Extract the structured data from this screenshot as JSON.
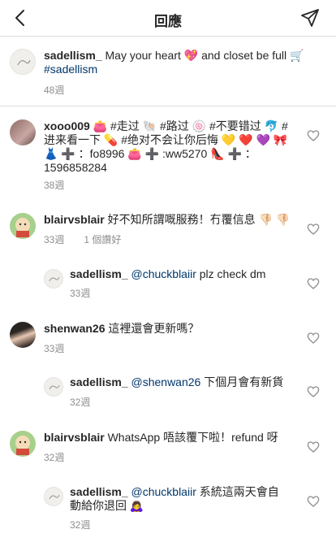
{
  "header": {
    "title": "回應"
  },
  "caption": {
    "username": "sadellism_",
    "text": " May your heart 💖 and closet be full 🛒",
    "tag": "#sadellism",
    "time": "48週"
  },
  "comments": [
    {
      "username": "xooo009",
      "line1": " 👛 #走过 🐚 #路过 🍥 #不要错过 🐬 #",
      "line2": "进来看一下 💊 #绝对不会让你后悔 💛 ❤️ 💜 🎀",
      "line3": "👗 ➕ ：fo8996 👛 ➕ :ww5270 👠 ➕ ：",
      "line4": "1596858284",
      "time": "38週",
      "likes": ""
    },
    {
      "username": "blairvsblair",
      "text": " 好不知所謂嘅服務！冇覆信息 👎🏻 👎🏻",
      "time": "33週",
      "likes": "1 個讚好"
    },
    {
      "username": "sadellism_",
      "mention": "@chuckblaiir",
      "text": " plz check dm",
      "time": "33週"
    },
    {
      "username": "shenwan26",
      "text": " 這裡還會更新嗎？",
      "time": "33週"
    },
    {
      "username": "sadellism_",
      "mention": "@shenwan26",
      "text": " 下個月會有新貨",
      "time": "32週"
    },
    {
      "username": "blairvsblair",
      "text": " WhatsApp 唔該覆下啦！refund 呀",
      "time": "32週"
    },
    {
      "username": "sadellism_",
      "mention": "@chuckblaiir",
      "text": " 系統這兩天會自",
      "line2": "動給你退回 🙇‍♀️",
      "time": "32週"
    }
  ]
}
